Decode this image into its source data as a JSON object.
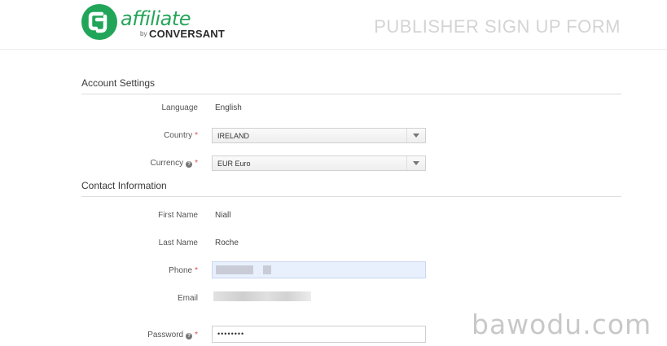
{
  "header": {
    "logo_word": "affiliate",
    "logo_by": "by",
    "logo_brand": "CONVERSANT",
    "page_title": "PUBLISHER SIGN UP FORM"
  },
  "account_settings": {
    "heading": "Account Settings",
    "language": {
      "label": "Language",
      "value": "English"
    },
    "country": {
      "label": "Country",
      "value": "IRELAND",
      "required": "*"
    },
    "currency": {
      "label": "Currency",
      "value": "EUR Euro",
      "required": "*"
    }
  },
  "contact_information": {
    "heading": "Contact Information",
    "first_name": {
      "label": "First Name",
      "value": "Niall"
    },
    "last_name": {
      "label": "Last Name",
      "value": "Roche"
    },
    "phone": {
      "label": "Phone",
      "required": "*"
    },
    "email": {
      "label": "Email"
    },
    "password": {
      "label": "Password",
      "value": "••••••••",
      "required": "*"
    }
  },
  "watermark": "bawodu.com",
  "colors": {
    "brand_green": "#21a559",
    "required_red": "#d9534f",
    "autofill_blue": "#e8f0fe"
  }
}
